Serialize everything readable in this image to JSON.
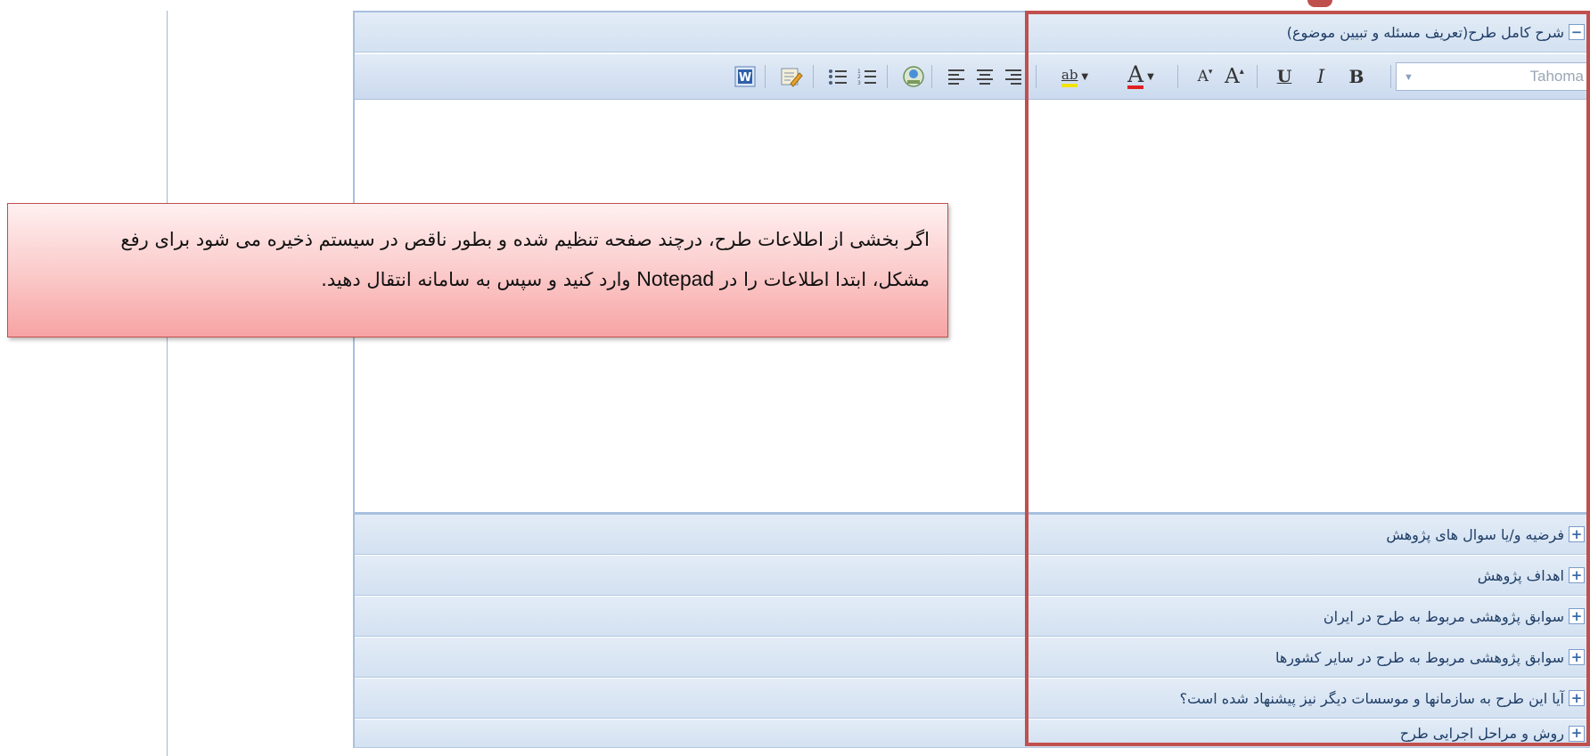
{
  "editor": {
    "section_title": "شرح کامل طرح(تعریف مسئله و تبیین موضوع)",
    "font_name": "Tahoma",
    "toolbar_buttons": {
      "bold": "B",
      "italic": "I",
      "underline": "U",
      "grow_font": "A",
      "shrink_font": "A",
      "font_color": "A",
      "highlight": "ab"
    }
  },
  "sections": [
    {
      "label": "فرضیه و/یا سوال های پژوهش"
    },
    {
      "label": "اهداف پژوهش"
    },
    {
      "label": "سوابق پژوهشی مربوط به طرح در ایران"
    },
    {
      "label": "سوابق پژوهشی مربوط به طرح در سایر کشورها"
    },
    {
      "label": "آیا این طرح به سازمانها و موسسات دیگر نیز پیشنهاد شده است؟"
    },
    {
      "label": "روش و مراحل اجرایی طرح"
    }
  ],
  "toggles": {
    "collapse": "−",
    "expand": "+"
  },
  "callout": {
    "line1": "اگر بخشی از اطلاعات طرح، درچند صفحه تنظیم شده و بطور ناقص در سیستم ذخیره می شود برای رفع",
    "line2_part1": "مشکل، ابتدا اطلاعات را در",
    "line2_app": "Notepad",
    "line2_part2": "وارد کنید و سپس به سامانه انتقال دهید."
  },
  "colors": {
    "accent_red": "#c0504d",
    "header_blue": "#d3e1f1",
    "callout_pink": "#f7a3a3"
  }
}
